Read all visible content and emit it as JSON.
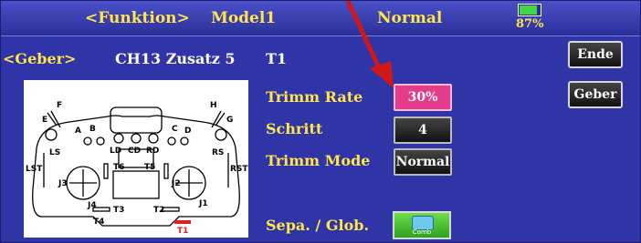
{
  "topbar": {
    "function_label": "<Funktion>",
    "model_label": "Model1",
    "mode_label": "Normal",
    "battery_percent": "87%",
    "battery_level": 0.87
  },
  "header": {
    "geber_label": "<Geber>",
    "channel_label": "CH13 Zusatz 5",
    "trim_name": "T1"
  },
  "buttons": {
    "ende_label": "Ende",
    "geber_label": "Geber"
  },
  "settings": {
    "trimm_rate_label": "Trimm Rate",
    "trimm_rate_value": "30%",
    "schritt_label": "Schritt",
    "schritt_value": "4",
    "trimm_mode_label": "Trimm Mode",
    "trimm_mode_value": "Normal",
    "sepa_label": "Sepa. / Glob.",
    "comb_label": "Comb"
  },
  "transmitter": {
    "labels": [
      "F",
      "E",
      "H",
      "G",
      "A",
      "B",
      "C",
      "D",
      "LD",
      "CD",
      "RD",
      "LS",
      "RS",
      "LST",
      "RST",
      "T6",
      "T5",
      "J3",
      "J4",
      "J2",
      "J1",
      "T3",
      "T2",
      "T4",
      "T1"
    ],
    "highlight_label": "T1",
    "highlight_color": "#e02020"
  },
  "colors": {
    "background": "#2f35a6",
    "label_yellow": "#ffe44a",
    "rate_pink": "#e23c8a",
    "comb_green": "#43c33a",
    "annotation_red": "#d01818"
  }
}
